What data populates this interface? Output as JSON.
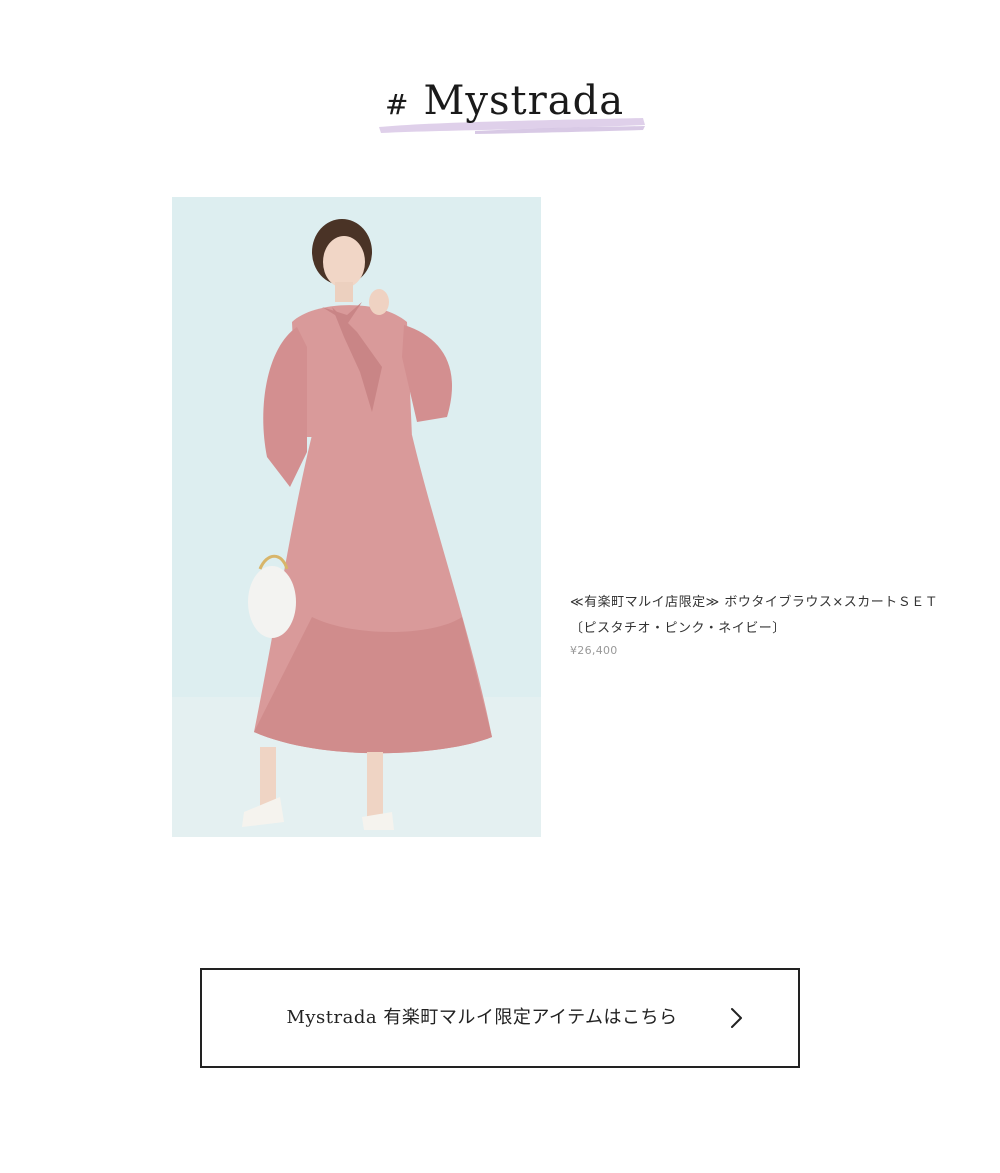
{
  "heading": {
    "hash": "#",
    "title": "Mystrada"
  },
  "product": {
    "name_line1": "≪有楽町マルイ店限定≫ ボウタイブラウス×スカートＳＥＴ",
    "name_line2": "〔ピスタチオ・ピンク・ネイビー〕",
    "price": "¥26,400",
    "photo_icon": "model-photo"
  },
  "cta": {
    "label": "Mystrada 有楽町マルイ限定アイテムはこちら",
    "icon": "chevron-right-icon"
  },
  "colors": {
    "brush": "#d9c8e6",
    "photo_bg": "#ddeef0",
    "outfit": "#d99a9a",
    "price": "#999999",
    "border": "#222222"
  }
}
